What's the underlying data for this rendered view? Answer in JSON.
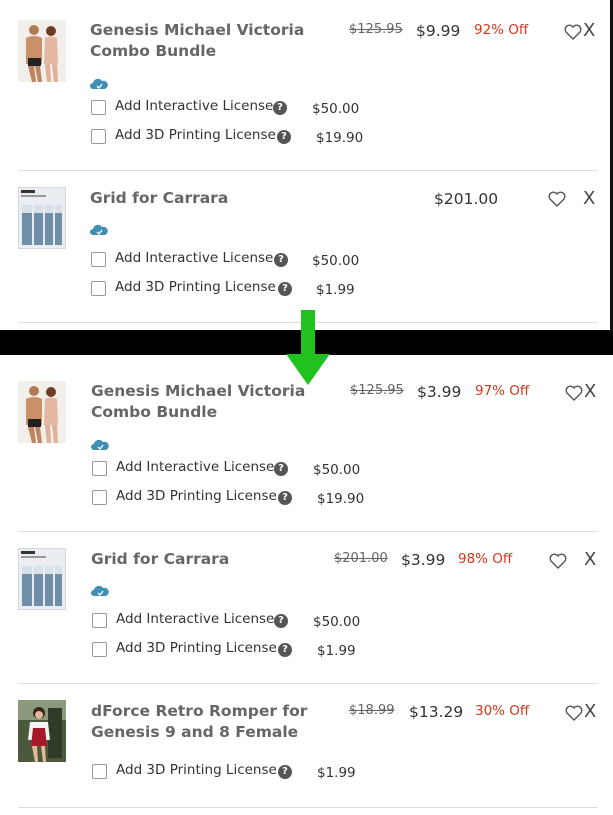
{
  "before": {
    "items": [
      {
        "name": "Genesis Michael Victoria Combo Bundle",
        "original_price": "$125.95",
        "price": "$9.99",
        "discount": "92% Off",
        "remove": "X",
        "licenses": [
          {
            "label": "Add Interactive License",
            "price": "$50.00"
          },
          {
            "label": "Add 3D Printing License",
            "price": "$19.90"
          }
        ]
      },
      {
        "name": "Grid for Carrara",
        "price": "$201.00",
        "remove": "X",
        "licenses": [
          {
            "label": "Add Interactive License",
            "price": "$50.00"
          },
          {
            "label": "Add 3D Printing License",
            "price": "$1.99"
          }
        ]
      }
    ]
  },
  "after": {
    "items": [
      {
        "name": "Genesis Michael Victoria Combo Bundle",
        "original_price": "$125.95",
        "price": "$3.99",
        "discount": "97% Off",
        "remove": "X",
        "licenses": [
          {
            "label": "Add Interactive License",
            "price": "$50.00"
          },
          {
            "label": "Add 3D Printing License",
            "price": "$19.90"
          }
        ]
      },
      {
        "name": "Grid for Carrara",
        "original_price": "$201.00",
        "price": "$3.99",
        "discount": "98% Off",
        "remove": "X",
        "licenses": [
          {
            "label": "Add Interactive License",
            "price": "$50.00"
          },
          {
            "label": "Add 3D Printing License",
            "price": "$1.99"
          }
        ]
      },
      {
        "name": "dForce Retro Romper for Genesis 9 and 8 Female",
        "original_price": "$18.99",
        "price": "$13.29",
        "discount": "30% Off",
        "remove": "X",
        "licenses": [
          {
            "label": "Add 3D Printing License",
            "price": "$1.99"
          }
        ]
      }
    ]
  },
  "help_glyph": "?",
  "colors": {
    "discount": "#d2391c",
    "arrow": "#22c21e",
    "cloud_icon": "#3f8fb5"
  },
  "icons": [
    "heart-icon",
    "cloud-icon",
    "help-icon",
    "down-arrow-icon"
  ]
}
